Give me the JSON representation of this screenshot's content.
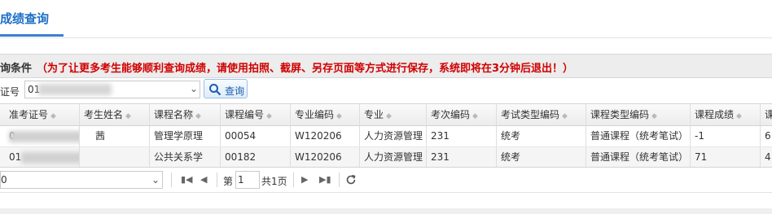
{
  "tab": {
    "title": "成绩查询"
  },
  "conditions": {
    "label": "询条件",
    "warning": "（为了让更多考生能够顺利查询成绩，请使用拍照、截屏、另存页面等方式进行保存，系统即将在3分钟后退出！）"
  },
  "search": {
    "field_label": "证号",
    "field_value": "01",
    "query_label": "查询"
  },
  "grid": {
    "columns": [
      "准考证号",
      "考生姓名",
      "课程名称",
      "课程编号",
      "专业编码",
      "专业",
      "考次编码",
      "考试类型编码",
      "课程类型编码",
      "课程成绩",
      "课"
    ],
    "rows": [
      [
        "0",
        "茜",
        "管理学原理",
        "00054",
        "W120206",
        "人力资源管理",
        "231",
        "统考",
        "普通课程（统考笔试）",
        "-1",
        "6"
      ],
      [
        "01",
        "",
        "公共关系学",
        "00182",
        "W120206",
        "人力资源管理",
        "231",
        "统考",
        "普通课程（统考笔试）",
        "71",
        "4"
      ]
    ]
  },
  "pager": {
    "page_size": "0",
    "page_prefix": "第",
    "current_page": "1",
    "total": "共1页"
  },
  "icons": [
    "search-icon",
    "first-page-icon",
    "prev-page-icon",
    "next-page-icon",
    "last-page-icon",
    "refresh-icon",
    "chevron-down-icon",
    "sort-icon"
  ],
  "colors": {
    "accent": "#1e6fc8",
    "warning": "#d00000"
  }
}
